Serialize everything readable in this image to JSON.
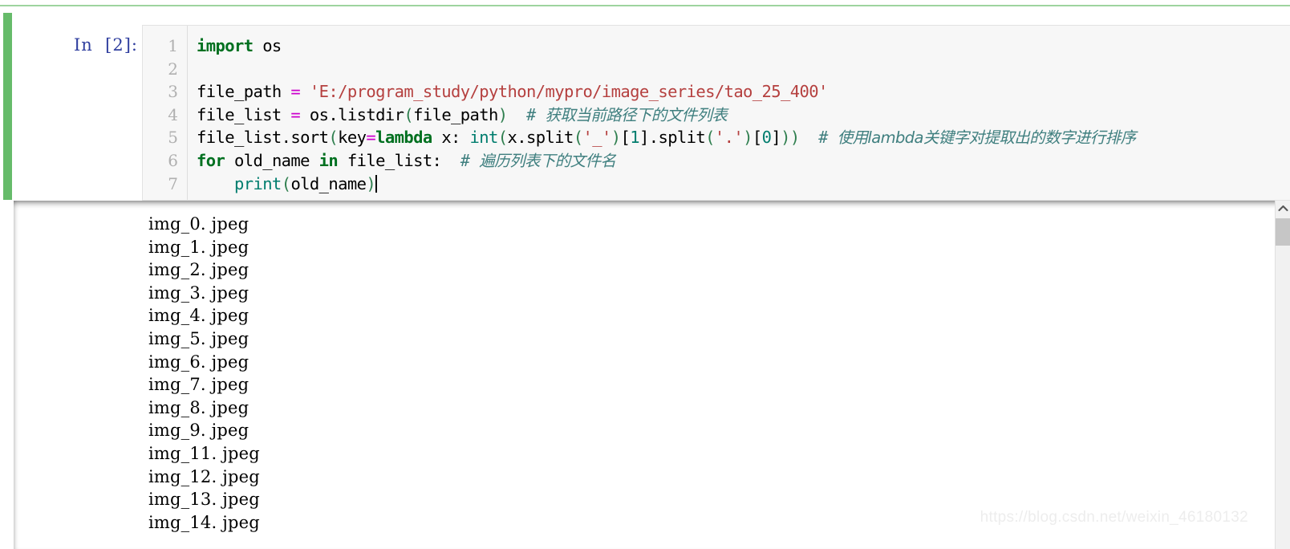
{
  "notebook": {
    "input_prompt": "In  [2]:",
    "cell_state_color": "#66bb6a",
    "prompt_color": "#303f9f"
  },
  "editor": {
    "line_numbers": [
      "1",
      "2",
      "3",
      "4",
      "5",
      "6",
      "7"
    ],
    "lines": [
      {
        "number": "1",
        "plain": "import os",
        "tokens": [
          {
            "type": "kw",
            "text": "import"
          },
          {
            "type": "plain",
            "text": " os"
          }
        ]
      },
      {
        "number": "2",
        "plain": "",
        "tokens": []
      },
      {
        "number": "3",
        "plain": "file_path = 'E:/program_study/python/mypro/image_series/tao_25_400'",
        "tokens": [
          {
            "type": "plain",
            "text": "file_path "
          },
          {
            "type": "op",
            "text": "="
          },
          {
            "type": "plain",
            "text": " "
          },
          {
            "type": "str",
            "text": "'E:/program_study/python/mypro/image_series/tao_25_400'"
          }
        ]
      },
      {
        "number": "4",
        "plain": "file_list = os.listdir(file_path)  # 获取当前路径下的文件列表",
        "tokens": [
          {
            "type": "plain",
            "text": "file_list "
          },
          {
            "type": "op",
            "text": "="
          },
          {
            "type": "plain",
            "text": " os."
          },
          {
            "type": "plain",
            "text": "listdir"
          },
          {
            "type": "punc",
            "text": "("
          },
          {
            "type": "plain",
            "text": "file_path"
          },
          {
            "type": "punc",
            "text": ")"
          },
          {
            "type": "plain",
            "text": "  "
          },
          {
            "type": "comment",
            "text": "# "
          },
          {
            "type": "comment-cn",
            "text": "获取当前路径下的文件列表"
          }
        ]
      },
      {
        "number": "5",
        "plain": "file_list.sort(key=lambda x: int(x.split('_')[1].split('.')[0]))  # 使用lambda关键字对提取出的数字进行排序",
        "tokens": [
          {
            "type": "plain",
            "text": "file_list.sort"
          },
          {
            "type": "punc",
            "text": "("
          },
          {
            "type": "plain",
            "text": "key"
          },
          {
            "type": "op",
            "text": "="
          },
          {
            "type": "kw",
            "text": "lambda"
          },
          {
            "type": "plain",
            "text": " x: "
          },
          {
            "type": "builtin",
            "text": "int"
          },
          {
            "type": "punc",
            "text": "("
          },
          {
            "type": "plain",
            "text": "x.split"
          },
          {
            "type": "punc",
            "text": "("
          },
          {
            "type": "str",
            "text": "'_'"
          },
          {
            "type": "punc",
            "text": ")"
          },
          {
            "type": "plain",
            "text": "["
          },
          {
            "type": "builtin",
            "text": "1"
          },
          {
            "type": "plain",
            "text": "].split"
          },
          {
            "type": "punc",
            "text": "("
          },
          {
            "type": "str",
            "text": "'.'"
          },
          {
            "type": "punc",
            "text": ")"
          },
          {
            "type": "plain",
            "text": "["
          },
          {
            "type": "builtin",
            "text": "0"
          },
          {
            "type": "plain",
            "text": "]"
          },
          {
            "type": "punc",
            "text": "))"
          },
          {
            "type": "plain",
            "text": "  "
          },
          {
            "type": "comment",
            "text": "# "
          },
          {
            "type": "comment-cn",
            "text": "使用lambda关键字对提取出的数字进行排序"
          }
        ]
      },
      {
        "number": "6",
        "plain": "for old_name in file_list:  # 遍历列表下的文件名",
        "tokens": [
          {
            "type": "kw",
            "text": "for"
          },
          {
            "type": "plain",
            "text": " old_name "
          },
          {
            "type": "kw",
            "text": "in"
          },
          {
            "type": "plain",
            "text": " file_list:"
          },
          {
            "type": "plain",
            "text": "  "
          },
          {
            "type": "comment",
            "text": "# "
          },
          {
            "type": "comment-cn",
            "text": "遍历列表下的文件名"
          }
        ]
      },
      {
        "number": "7",
        "plain": "    print(old_name)",
        "cursor_at_end": true,
        "tokens": [
          {
            "type": "plain",
            "text": "    "
          },
          {
            "type": "builtin",
            "text": "print"
          },
          {
            "type": "punc",
            "text": "("
          },
          {
            "type": "plain",
            "text": "old_name"
          },
          {
            "type": "punc",
            "text": ")"
          }
        ]
      }
    ]
  },
  "output": {
    "lines": [
      "img_0. jpeg",
      "img_1. jpeg",
      "img_2. jpeg",
      "img_3. jpeg",
      "img_4. jpeg",
      "img_5. jpeg",
      "img_6. jpeg",
      "img_7. jpeg",
      "img_8. jpeg",
      "img_9. jpeg",
      "img_11. jpeg",
      "img_12. jpeg",
      "img_13. jpeg",
      "img_14. jpeg"
    ]
  },
  "scrollbar": {
    "up_arrow_icon": "chevron-up-icon",
    "thumb_position_percent": 5
  },
  "watermark": {
    "text": "https://blog.csdn.net/weixin_46180132"
  }
}
